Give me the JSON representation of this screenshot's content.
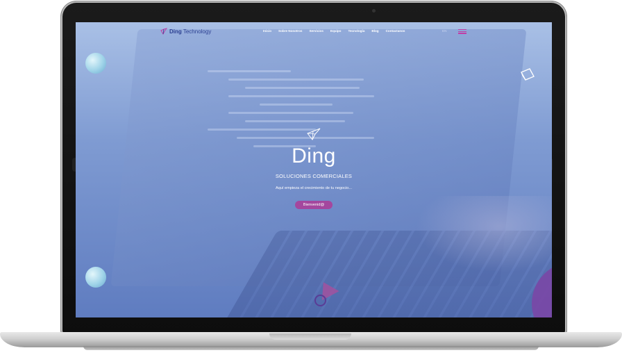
{
  "nav": {
    "logo_strong": "Ding",
    "logo_light": "Technology",
    "links": [
      "Inicio",
      "Sobre Nosotros",
      "Servicios",
      "Equipo",
      "Tecnología",
      "Blog",
      "Contactanos"
    ],
    "lang": "EN"
  },
  "hero": {
    "title": "Ding",
    "subtitle": "SOLUCIONES COMERCIALES",
    "tagline": "Aquí empieza el crecimiento de tu negocio...",
    "button_label": "Bienvenid@"
  },
  "colors": {
    "brand_blue": "#2b3f91",
    "accent_purple": "#a4479e",
    "hamburger": "#c03fa6"
  },
  "icons": [
    "crane-logo-icon",
    "menu-icon",
    "cube-icon"
  ]
}
